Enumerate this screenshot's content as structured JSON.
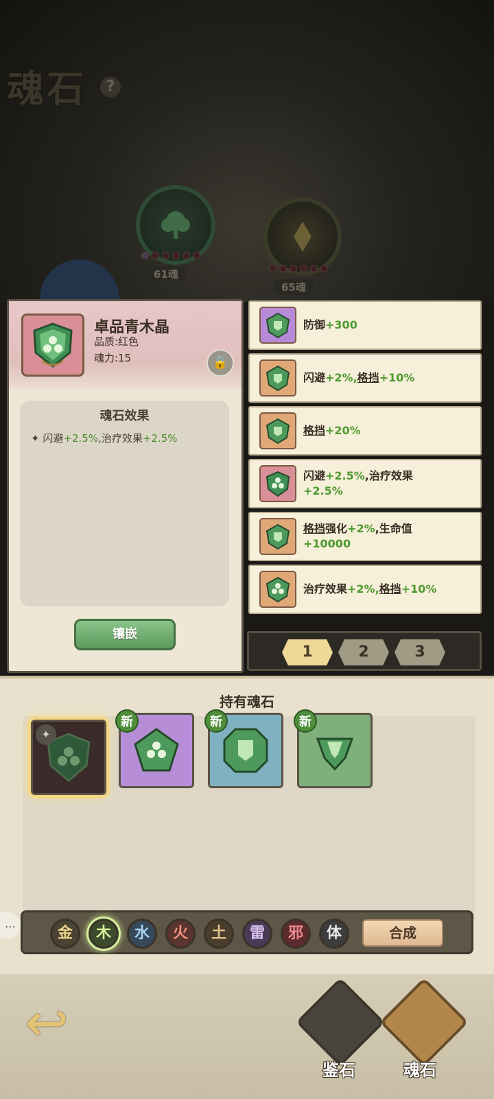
{
  "header": {
    "title": "魂石",
    "help_label": "?"
  },
  "slots": [
    {
      "label": "61魂",
      "icon": "tree-icon",
      "color": "#3f6b47"
    },
    {
      "label": "65魂",
      "icon": "diamond-icon",
      "color": "#6b6036"
    }
  ],
  "detail": {
    "name": "卓品青木晶",
    "quality": "品质:红色",
    "power": "魂力:15",
    "effect_title": "魂石效果",
    "effect_bullet": "✦",
    "effect_a": "闪避",
    "effect_a_val": "+2.5%",
    "effect_sep": ",治疗效果",
    "effect_b_val": "+2.5%",
    "equip_label": "镶嵌"
  },
  "list": [
    {
      "line1": "防御",
      "g1": "+300",
      "icon_bg": "#b78ad8"
    },
    {
      "line1": "闪避",
      "g1": "+2%,",
      "u1": "格挡",
      "g2": "+10%",
      "icon_bg": "#e0a877"
    },
    {
      "line1": "",
      "u1": "格挡",
      "g1": "+20%",
      "icon_bg": "#e0a877"
    },
    {
      "line1": "闪避",
      "g1": "+2.5%",
      "rest": ",治疗效果",
      "line2": "+2.5%",
      "icon_bg": "#d98f97"
    },
    {
      "u1": "格挡",
      "pre": "强化",
      "g1": "+2%",
      "rest": ",生命值",
      "line2": "+10000",
      "icon_bg": "#e0a877"
    },
    {
      "line1": "治疗效果",
      "g1": "+2%,",
      "u1": "格挡",
      "g2": "+10%",
      "icon_bg": "#e0a877"
    }
  ],
  "pages": [
    "1",
    "2",
    "3"
  ],
  "inventory": {
    "title": "持有魂石",
    "new_label": "新",
    "items": [
      {
        "bg": "#3a2a2a",
        "new": false
      },
      {
        "bg": "#b68dd6",
        "new": true
      },
      {
        "bg": "#7fb1c0",
        "new": true
      },
      {
        "bg": "#7fb07b",
        "new": true
      }
    ]
  },
  "filters": [
    {
      "label": "金",
      "bg": "#4a4232",
      "color": "#e8d38a"
    },
    {
      "label": "木",
      "bg": "#3e4a2e",
      "color": "#d7f09a",
      "active": true
    },
    {
      "label": "水",
      "bg": "#36495a",
      "color": "#a6d3f2"
    },
    {
      "label": "火",
      "bg": "#5a3530",
      "color": "#f2917f"
    },
    {
      "label": "土",
      "bg": "#4a3d2c",
      "color": "#e0c28a"
    },
    {
      "label": "雷",
      "bg": "#4a3a55",
      "color": "#d8c2f0"
    },
    {
      "label": "邪",
      "bg": "#5a2a2f",
      "color": "#f08a8f"
    },
    {
      "label": "体",
      "bg": "#3c3c3c",
      "color": "#e8e8e8"
    }
  ],
  "merge_label": "合成",
  "chat_label": "…",
  "nav": {
    "back": "↩",
    "appraise": "鉴石",
    "soulstone": "魂石"
  }
}
